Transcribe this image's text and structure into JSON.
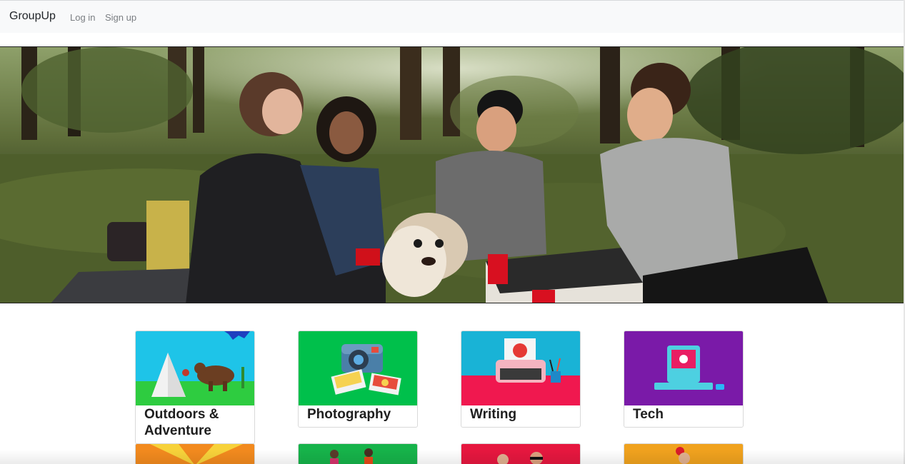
{
  "nav": {
    "brand": "GroupUp",
    "links": [
      "Log in",
      "Sign up"
    ]
  },
  "hero": {
    "image": "group-picnic-photo"
  },
  "categories": [
    {
      "title": "Outdoors & Adventure",
      "image": "tent-bear-illustration",
      "color": "#00c853"
    },
    {
      "title": "Photography",
      "image": "instant-camera-illustration",
      "color": "#00c853"
    },
    {
      "title": "Writing",
      "image": "typewriter-illustration",
      "color": "#e91e63"
    },
    {
      "title": "Tech",
      "image": "retro-computer-illustration",
      "color": "#7b1fa2"
    }
  ],
  "second_row": [
    "orange-rays-card",
    "green-people-card",
    "red-people-card",
    "orange-people-card"
  ]
}
